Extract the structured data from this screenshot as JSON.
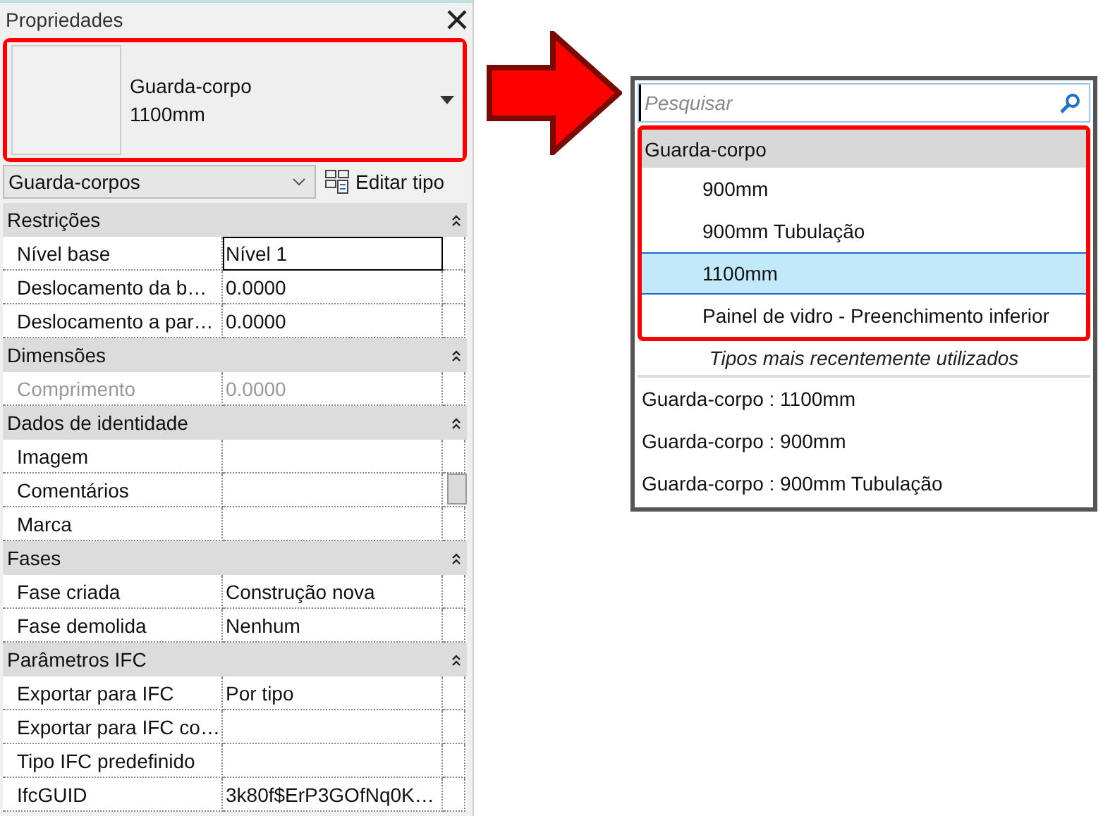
{
  "properties_panel": {
    "title": "Propriedades",
    "type_selector": {
      "family": "Guarda-corpo",
      "type": "1100mm"
    },
    "category_filter": "Guarda-corpos",
    "edit_type_button": "Editar tipo",
    "groups": [
      {
        "name": "Restrições",
        "expanded": true,
        "rows": [
          {
            "label": "Nível base",
            "value": "Nível 1",
            "disabled": false,
            "focused": true
          },
          {
            "label": "Deslocamento da b…",
            "value": "0.0000",
            "disabled": false,
            "focused": false
          },
          {
            "label": "Deslocamento a par…",
            "value": "0.0000",
            "disabled": false,
            "focused": false
          }
        ]
      },
      {
        "name": "Dimensões",
        "expanded": true,
        "rows": [
          {
            "label": "Comprimento",
            "value": "0.0000",
            "disabled": true,
            "focused": false
          }
        ]
      },
      {
        "name": "Dados de identidade",
        "expanded": true,
        "rows": [
          {
            "label": "Imagem",
            "value": "",
            "disabled": false,
            "focused": false
          },
          {
            "label": "Comentários",
            "value": "",
            "disabled": false,
            "focused": false
          },
          {
            "label": "Marca",
            "value": "",
            "disabled": false,
            "focused": false
          }
        ]
      },
      {
        "name": "Fases",
        "expanded": true,
        "rows": [
          {
            "label": "Fase criada",
            "value": "Construção nova",
            "disabled": false,
            "focused": false
          },
          {
            "label": "Fase demolida",
            "value": "Nenhum",
            "disabled": false,
            "focused": false
          }
        ]
      },
      {
        "name": "Parâmetros IFC",
        "expanded": true,
        "rows": [
          {
            "label": "Exportar para IFC",
            "value": "Por tipo",
            "disabled": false,
            "focused": false
          },
          {
            "label": "Exportar para IFC co…",
            "value": "",
            "disabled": false,
            "focused": false
          },
          {
            "label": "Tipo IFC predefinido",
            "value": "",
            "disabled": false,
            "focused": false
          },
          {
            "label": "IfcGUID",
            "value": "3k80f$ErP3GOfNq0K…",
            "disabled": false,
            "focused": false
          }
        ]
      }
    ]
  },
  "type_dropdown": {
    "search": {
      "placeholder": "Pesquisar"
    },
    "family": "Guarda-corpo",
    "types": [
      {
        "label": "900mm",
        "selected": false
      },
      {
        "label": "900mm Tubulação",
        "selected": false
      },
      {
        "label": "1100mm",
        "selected": true
      },
      {
        "label": "Painel de vidro - Preenchimento inferior",
        "selected": false
      }
    ],
    "recent_heading": "Tipos mais recentemente utilizados",
    "recent": [
      "Guarda-corpo : 1100mm",
      "Guarda-corpo : 900mm",
      "Guarda-corpo : 900mm Tubulação"
    ]
  }
}
